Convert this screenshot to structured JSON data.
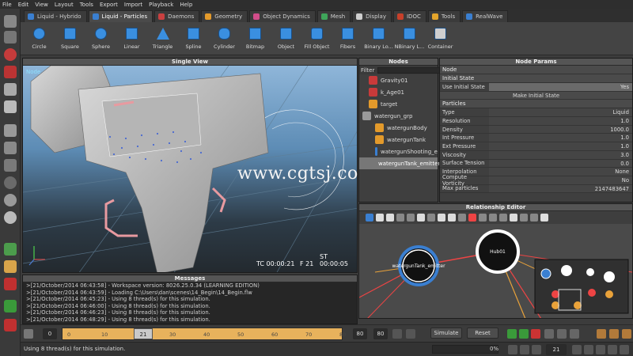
{
  "menu": [
    "File",
    "Edit",
    "View",
    "Layout",
    "Tools",
    "Export",
    "Import",
    "Playback",
    "Help"
  ],
  "tabs": [
    {
      "label": "Liquid - Hybrido",
      "color": "#3a7fd1",
      "active": false
    },
    {
      "label": "Liquid - Particles",
      "color": "#3a7fd1",
      "active": true
    },
    {
      "label": "Daemons",
      "color": "#c94040",
      "active": false
    },
    {
      "label": "Geometry",
      "color": "#e39a2b",
      "active": false
    },
    {
      "label": "Object Dynamics",
      "color": "#d24d8a",
      "active": false
    },
    {
      "label": "Mesh",
      "color": "#3fa55a",
      "active": false
    },
    {
      "label": "Display",
      "color": "#cfcfcf",
      "active": false
    },
    {
      "label": "IDOC",
      "color": "#c7402a",
      "active": false
    },
    {
      "label": "Tools",
      "color": "#e3a42b",
      "active": false
    },
    {
      "label": "RealWave",
      "color": "#3a7fd1",
      "active": false
    }
  ],
  "toolbar": [
    {
      "label": "Circle",
      "icon": "circle-emitter-icon"
    },
    {
      "label": "Square",
      "icon": "square-emitter-icon"
    },
    {
      "label": "Sphere",
      "icon": "sphere-emitter-icon"
    },
    {
      "label": "Linear",
      "icon": "linear-emitter-icon"
    },
    {
      "label": "Triangle",
      "icon": "triangle-emitter-icon"
    },
    {
      "label": "Spline",
      "icon": "spline-emitter-icon"
    },
    {
      "label": "Cylinder",
      "icon": "cylinder-emitter-icon"
    },
    {
      "label": "Bitmap",
      "icon": "bitmap-emitter-icon"
    },
    {
      "label": "Object",
      "icon": "object-emitter-icon"
    },
    {
      "label": "Fill Object",
      "icon": "fill-object-icon"
    },
    {
      "label": "Fibers",
      "icon": "fibers-emitter-icon"
    },
    {
      "label": "Binary Lo...",
      "icon": "binary-loader-icon"
    },
    {
      "label": "NBinary L...",
      "icon": "nbinary-loader-icon"
    },
    {
      "label": "Container",
      "icon": "container-icon"
    }
  ],
  "viewport": {
    "title": "Single View",
    "corner_label": "Node",
    "tc": "TC 00:00:21",
    "frame": "F 21",
    "st": "ST 00:00:05",
    "watermark": "www.cgtsj.com"
  },
  "nodes": {
    "title": "Nodes",
    "filter_label": "Filter",
    "items": [
      {
        "label": "Gravity01",
        "icon": "gravity-daemon-icon",
        "color": "#c83a3a",
        "indent": 1,
        "selected": false
      },
      {
        "label": "k_Age01",
        "icon": "k-age-daemon-icon",
        "color": "#c83a3a",
        "indent": 1,
        "selected": false
      },
      {
        "label": "target",
        "icon": "object-icon",
        "color": "#e39a2b",
        "indent": 1,
        "selected": false
      },
      {
        "label": "watergun_grp",
        "icon": "group-icon",
        "color": "#9a9a9a",
        "indent": 0,
        "selected": false
      },
      {
        "label": "watergunBody",
        "icon": "object-icon",
        "color": "#e39a2b",
        "indent": 2,
        "selected": false
      },
      {
        "label": "watergunTank",
        "icon": "object-icon",
        "color": "#e39a2b",
        "indent": 2,
        "selected": false
      },
      {
        "label": "watergunShooting_e",
        "icon": "emitter-icon",
        "color": "#3a7fd1",
        "indent": 2,
        "selected": false
      },
      {
        "label": "watergunTank_emitter",
        "icon": "emitter-icon",
        "color": "#3a7fd1",
        "indent": 2,
        "selected": true
      }
    ]
  },
  "params": {
    "title": "Node Params",
    "node_label": "Node",
    "initial_state_label": "Initial State",
    "use_initial_state_key": "Use Initial State",
    "use_initial_state_value": "Yes",
    "make_initial_state_button": "Make Initial State",
    "particles_section": "Particles",
    "rows": [
      {
        "key": "Type",
        "value": "Liquid"
      },
      {
        "key": "Resolution",
        "value": "1.0"
      },
      {
        "key": "Density",
        "value": "1000.0"
      },
      {
        "key": "Int Pressure",
        "value": "1.0"
      },
      {
        "key": "Ext Pressure",
        "value": "1.0"
      },
      {
        "key": "Viscosity",
        "value": "3.0"
      },
      {
        "key": "Surface Tension",
        "value": "0.0"
      },
      {
        "key": "Interpolation",
        "value": "None"
      },
      {
        "key": "Compute Vorticity",
        "value": "No"
      },
      {
        "key": "Max particles",
        "value": "2147483647"
      }
    ]
  },
  "relationship": {
    "title": "Relationship Editor",
    "node_a": "watergunTank_emitter",
    "node_b": "Hub01"
  },
  "messages": {
    "title": "Messages",
    "lines": [
      ">[21/October/2014 06:43:58] - Workspace version: 8026.25.0.34 (LEARNING EDITION)",
      ">[21/October/2014 06:43:59] - Loading C:\\Users\\dan\\scenes\\14_Begin\\14_Begin.flw",
      ">[21/October/2014 06:45:23] - Using 8 thread(s) for this simulation.",
      ">[21/October/2014 06:46:00] - Using 8 thread(s) for this simulation.",
      ">[21/October/2014 06:46:23] - Using 8 thread(s) for this simulation.",
      ">[21/October/2014 06:48:29] - Using 8 thread(s) for this simulation."
    ]
  },
  "timeline": {
    "start": "0",
    "current": "21",
    "ticks": [
      "0",
      "10",
      "20",
      "30",
      "40",
      "50",
      "60",
      "70",
      "80"
    ],
    "end_a": "80",
    "end_b": "80",
    "simulate_label": "Simulate",
    "reset_label": "Reset"
  },
  "status": {
    "text": "Using 8 thread(s) for this simulation.",
    "percent": "0%",
    "frame": "21"
  }
}
